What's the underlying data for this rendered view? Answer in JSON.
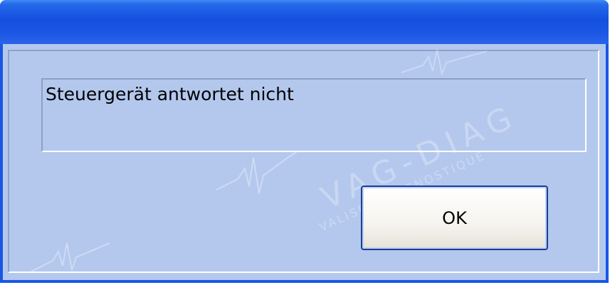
{
  "dialog": {
    "title": "",
    "message": "Steuergerät antwortet nicht",
    "ok_label": "OK"
  },
  "watermark": {
    "main": "VAG-DIAG",
    "sub": "VALISES DIAGNOSTIQUE"
  },
  "colors": {
    "titlebar": "#1450e0",
    "client": "#b4c8ee",
    "button_border": "#1c3f94"
  }
}
